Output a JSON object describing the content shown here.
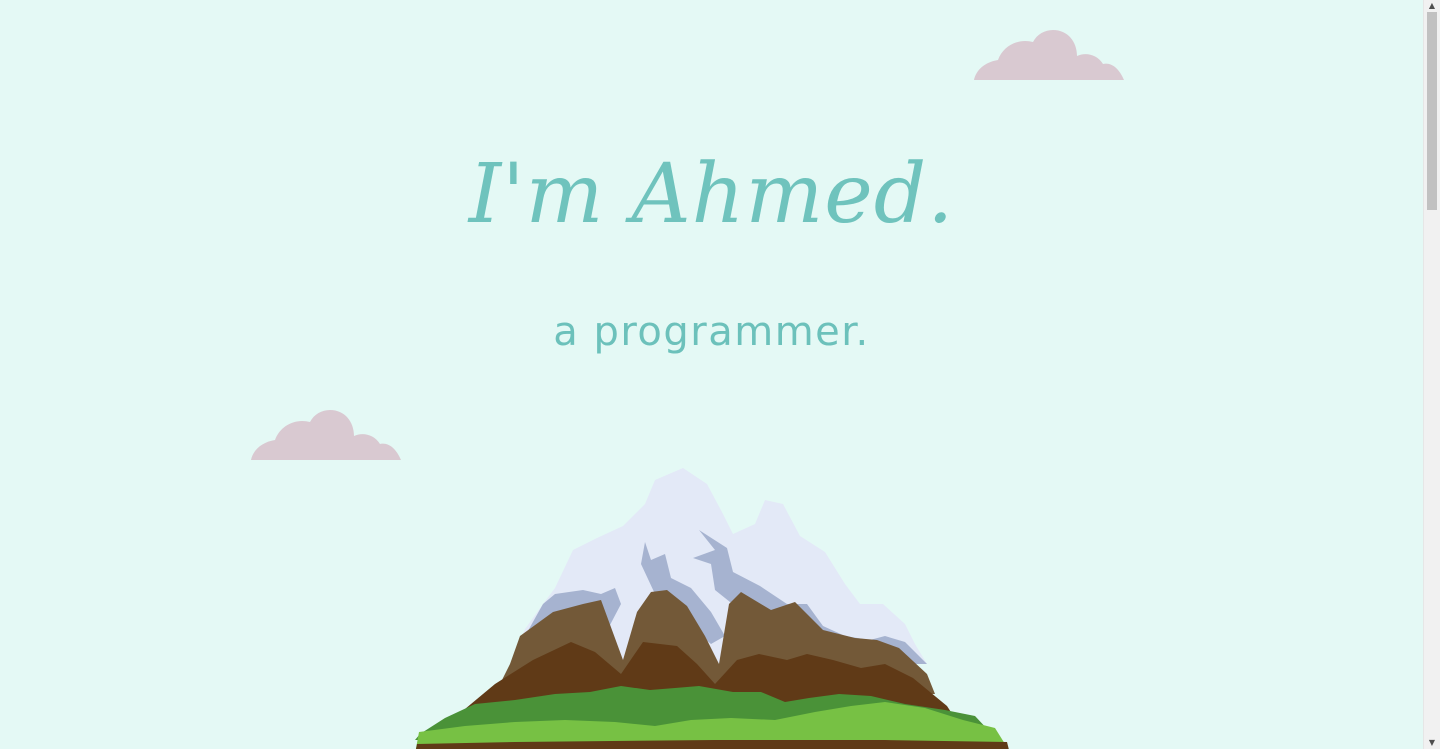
{
  "hero": {
    "title": "I'm Ahmed.",
    "subtitle": "a programmer."
  },
  "decor": {
    "clouds": [
      "cloud-icon",
      "cloud-icon"
    ],
    "illustration": "mountain-illustration"
  },
  "colors": {
    "background": "#e4f9f5",
    "accent": "#6fc3bd",
    "cloud": "#d9c9d1",
    "snow": "#e3e9f7",
    "snow_shadow": "#a6b3d0",
    "rock_light": "#735938",
    "rock_dark": "#603a17",
    "grass_dark": "#4a9238",
    "grass_light": "#77c144"
  },
  "scrollbar": {
    "up_glyph": "▲",
    "down_glyph": "▼"
  }
}
